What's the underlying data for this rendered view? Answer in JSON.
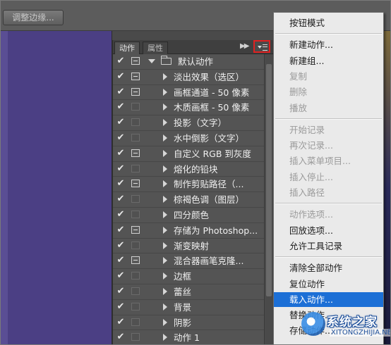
{
  "toolbar": {
    "refine_edge": "调整边缘..."
  },
  "panel": {
    "tabs": [
      "动作",
      "属性"
    ],
    "rows": [
      {
        "label": "默认动作",
        "kind": "set",
        "dialog": "on",
        "checked": true
      },
      {
        "label": "淡出效果（选区）",
        "kind": "action",
        "dialog": "on",
        "checked": true
      },
      {
        "label": "画框通道 - 50 像素",
        "kind": "action",
        "dialog": "on",
        "checked": true
      },
      {
        "label": "木质画框 - 50 像素",
        "kind": "action",
        "dialog": "off",
        "checked": true
      },
      {
        "label": "投影（文字）",
        "kind": "action",
        "dialog": "off",
        "checked": true
      },
      {
        "label": "水中倒影（文字）",
        "kind": "action",
        "dialog": "off",
        "checked": true
      },
      {
        "label": "自定义 RGB 到灰度",
        "kind": "action",
        "dialog": "on",
        "checked": true
      },
      {
        "label": "熔化的铅块",
        "kind": "action",
        "dialog": "off",
        "checked": true
      },
      {
        "label": "制作剪贴路径（...",
        "kind": "action",
        "dialog": "on",
        "checked": true
      },
      {
        "label": "棕褐色调（图层）",
        "kind": "action",
        "dialog": "off",
        "checked": true
      },
      {
        "label": "四分颜色",
        "kind": "action",
        "dialog": "off",
        "checked": true
      },
      {
        "label": "存储为 Photoshop...",
        "kind": "action",
        "dialog": "on",
        "checked": true
      },
      {
        "label": "渐变映射",
        "kind": "action",
        "dialog": "off",
        "checked": true
      },
      {
        "label": "混合器画笔克隆...",
        "kind": "action",
        "dialog": "on",
        "checked": true
      },
      {
        "label": "边框",
        "kind": "action",
        "dialog": "off",
        "checked": true
      },
      {
        "label": "蕾丝",
        "kind": "action",
        "dialog": "off",
        "checked": true
      },
      {
        "label": "背景",
        "kind": "action",
        "dialog": "off",
        "checked": true
      },
      {
        "label": "阴影",
        "kind": "action",
        "dialog": "off",
        "checked": true
      },
      {
        "label": "动作 1",
        "kind": "action",
        "dialog": "off",
        "checked": true
      }
    ]
  },
  "menu": {
    "items": [
      {
        "label": "按钮模式",
        "state": "enabled",
        "sep_after": true
      },
      {
        "label": "新建动作...",
        "state": "enabled"
      },
      {
        "label": "新建组...",
        "state": "enabled"
      },
      {
        "label": "复制",
        "state": "disabled"
      },
      {
        "label": "删除",
        "state": "disabled"
      },
      {
        "label": "播放",
        "state": "disabled",
        "sep_after": true
      },
      {
        "label": "开始记录",
        "state": "disabled"
      },
      {
        "label": "再次记录...",
        "state": "disabled"
      },
      {
        "label": "插入菜单项目...",
        "state": "disabled"
      },
      {
        "label": "插入停止...",
        "state": "disabled"
      },
      {
        "label": "插入路径",
        "state": "disabled",
        "sep_after": true
      },
      {
        "label": "动作选项...",
        "state": "disabled"
      },
      {
        "label": "回放选项...",
        "state": "enabled"
      },
      {
        "label": "允许工具记录",
        "state": "enabled",
        "sep_after": true
      },
      {
        "label": "清除全部动作",
        "state": "enabled"
      },
      {
        "label": "复位动作",
        "state": "enabled"
      },
      {
        "label": "载入动作...",
        "state": "highlighted"
      },
      {
        "label": "替换动作...",
        "state": "enabled"
      },
      {
        "label": "存储动作...",
        "state": "enabled"
      }
    ]
  },
  "watermark": {
    "text": "系统之家",
    "url": "XITONGZHIJIA.NET"
  },
  "colors": {
    "highlight": "#1c6fd6",
    "menu_bg": "#eaeaea",
    "panel_bg": "#545454",
    "red_outline": "#e02020",
    "workspace": "#4b3f84"
  }
}
